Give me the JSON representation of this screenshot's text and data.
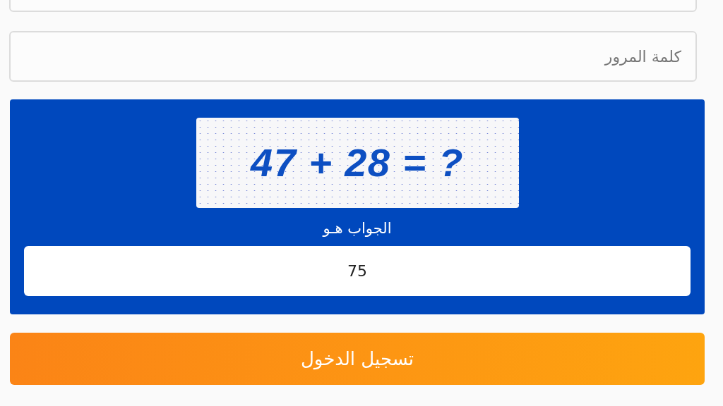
{
  "password_field": {
    "placeholder": "كلمة المرور"
  },
  "captcha": {
    "challenge": "47 + 28 = ?",
    "label": "الجواب هـو",
    "answer": "75"
  },
  "login_button": "تسجيل الدخول"
}
